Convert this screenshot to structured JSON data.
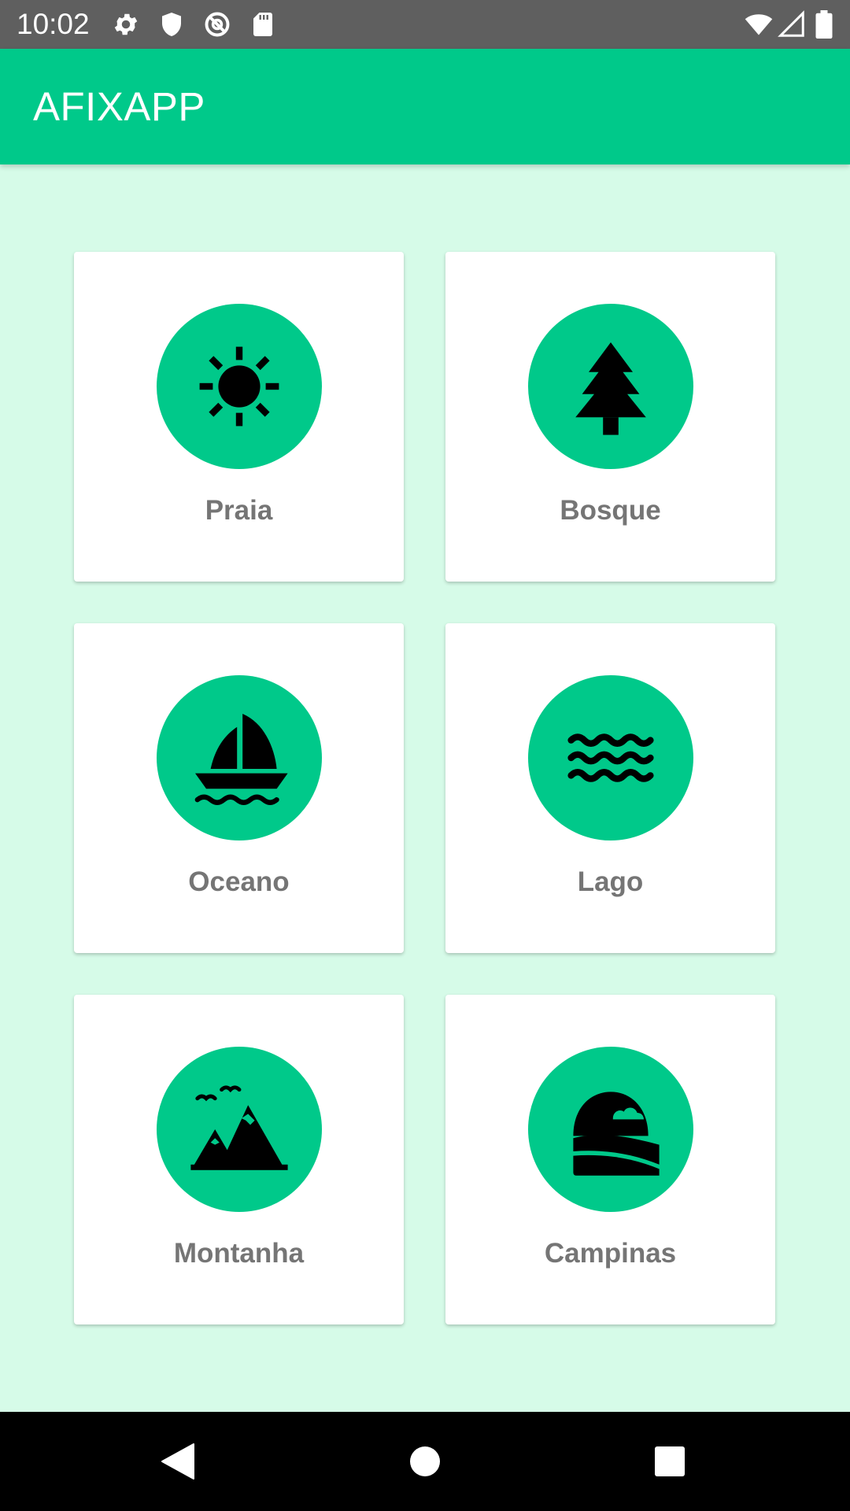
{
  "status_bar": {
    "time": "10:02",
    "left_icons": [
      "gear-icon",
      "shield-icon",
      "no-sync-icon",
      "sd-card-icon"
    ],
    "right_icons": [
      "wifi-icon",
      "signal-icon",
      "battery-icon"
    ]
  },
  "app_bar": {
    "title": "AFIXAPP"
  },
  "categories": [
    {
      "label": "Praia",
      "icon": "sun-icon"
    },
    {
      "label": "Bosque",
      "icon": "tree-icon"
    },
    {
      "label": "Oceano",
      "icon": "sailboat-icon"
    },
    {
      "label": "Lago",
      "icon": "waves-icon"
    },
    {
      "label": "Montanha",
      "icon": "mountain-icon"
    },
    {
      "label": "Campinas",
      "icon": "field-icon"
    }
  ],
  "nav_bar": {
    "buttons": [
      "back-icon",
      "home-icon",
      "recents-icon"
    ]
  },
  "colors": {
    "primary": "#00c98a",
    "background": "#d6fbe8",
    "label": "#757575"
  }
}
